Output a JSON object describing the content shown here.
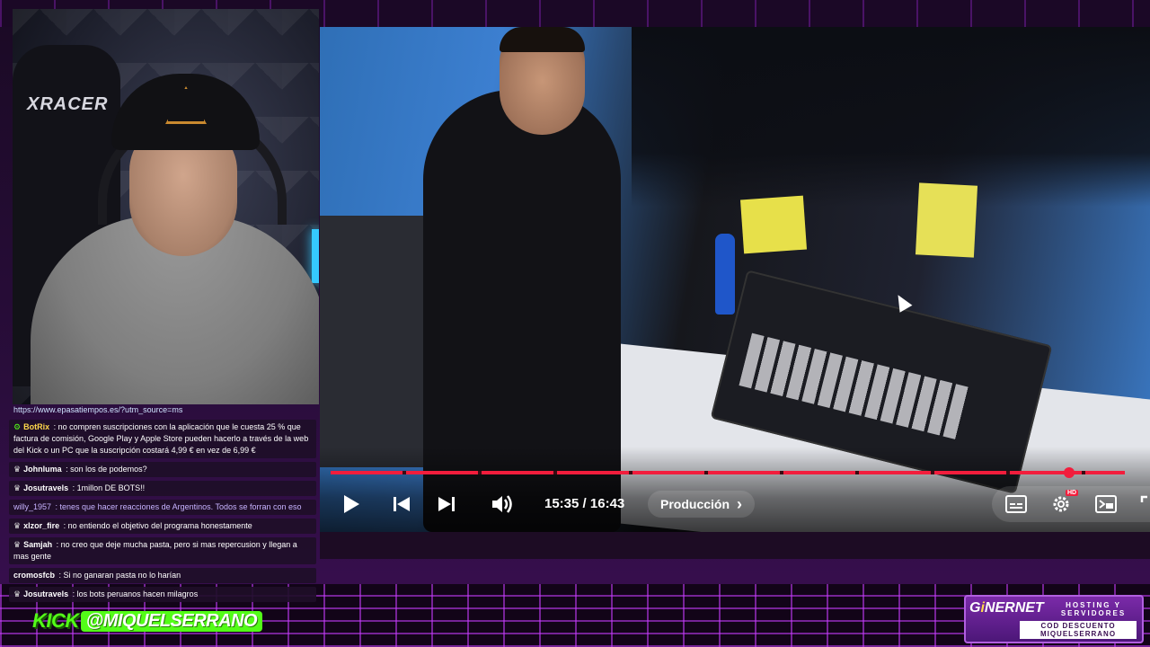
{
  "webcam": {
    "chair_brand": "XRACER"
  },
  "chat": {
    "messages": [
      {
        "user": "",
        "text": "https://www.epasatiempos.es/?utm_source=ms",
        "user_color": "#ffffff",
        "badge": ""
      },
      {
        "user": "BotRix",
        "text": " : no compren suscripciones con la aplicación que le cuesta 25 % que factura de comisión, Google Play y Apple Store pueden hacerlo a través de la web del Kick o un PC que la suscripción costará 4,99 € en vez de 6,99 €",
        "user_color": "#ffd84a",
        "badge": "⚙"
      },
      {
        "user": "Johnluma",
        "text": " : son los de podemos?",
        "user_color": "#ffffff",
        "badge": "♛"
      },
      {
        "user": "Josutravels",
        "text": " : 1millon DE BOTS!!",
        "user_color": "#ffffff",
        "badge": "♛"
      },
      {
        "user": "willy_1957",
        "text": " : tenes que hacer reacciones de Argentinos. Todos se forran con eso",
        "user_color": "#c7b3ff",
        "badge": ""
      },
      {
        "user": "xlzor_fire",
        "text": " : no entiendo el objetivo del programa honestamente",
        "user_color": "#ffffff",
        "badge": "♛"
      },
      {
        "user": "Samjah",
        "text": " : no creo que deje mucha pasta, pero si mas repercusion y llegan a mas gente",
        "user_color": "#ffffff",
        "badge": "♛"
      },
      {
        "user": "cromosfcb",
        "text": " : Si no ganaran pasta no lo harían",
        "user_color": "#ffffff",
        "badge": ""
      },
      {
        "user": "Josutravels",
        "text": " : los bots peruanos hacen milagros",
        "user_color": "#ffffff",
        "badge": "♛"
      }
    ]
  },
  "kick": {
    "brand": "KICK",
    "handle": "@MIQUELSERRANO"
  },
  "player": {
    "current_time": "15:35",
    "separator": " / ",
    "duration": "16:43",
    "chapter_label": "Producción",
    "chapter_arrow": "›",
    "hd_label": "HD",
    "progress": 0.93,
    "icons": [
      "play-icon",
      "skip-previous-icon",
      "skip-next-icon",
      "volume-icon",
      "subtitles-icon",
      "settings-icon",
      "miniplayer-icon",
      "fullscreen-icon"
    ]
  },
  "sponsor": {
    "logo_prefix": "G",
    "logo_accent": "i",
    "logo_suffix": "NERNET",
    "tag_line1": "HOSTING Y",
    "tag_line2": "SERVIDORES",
    "code_line1": "COD DESCUENTO",
    "code_line2": "MIQUELSERRANO"
  },
  "colors": {
    "accent_red": "#f21d3c",
    "kick_green": "#53fc18",
    "background_purple": "#2a0d3c"
  }
}
